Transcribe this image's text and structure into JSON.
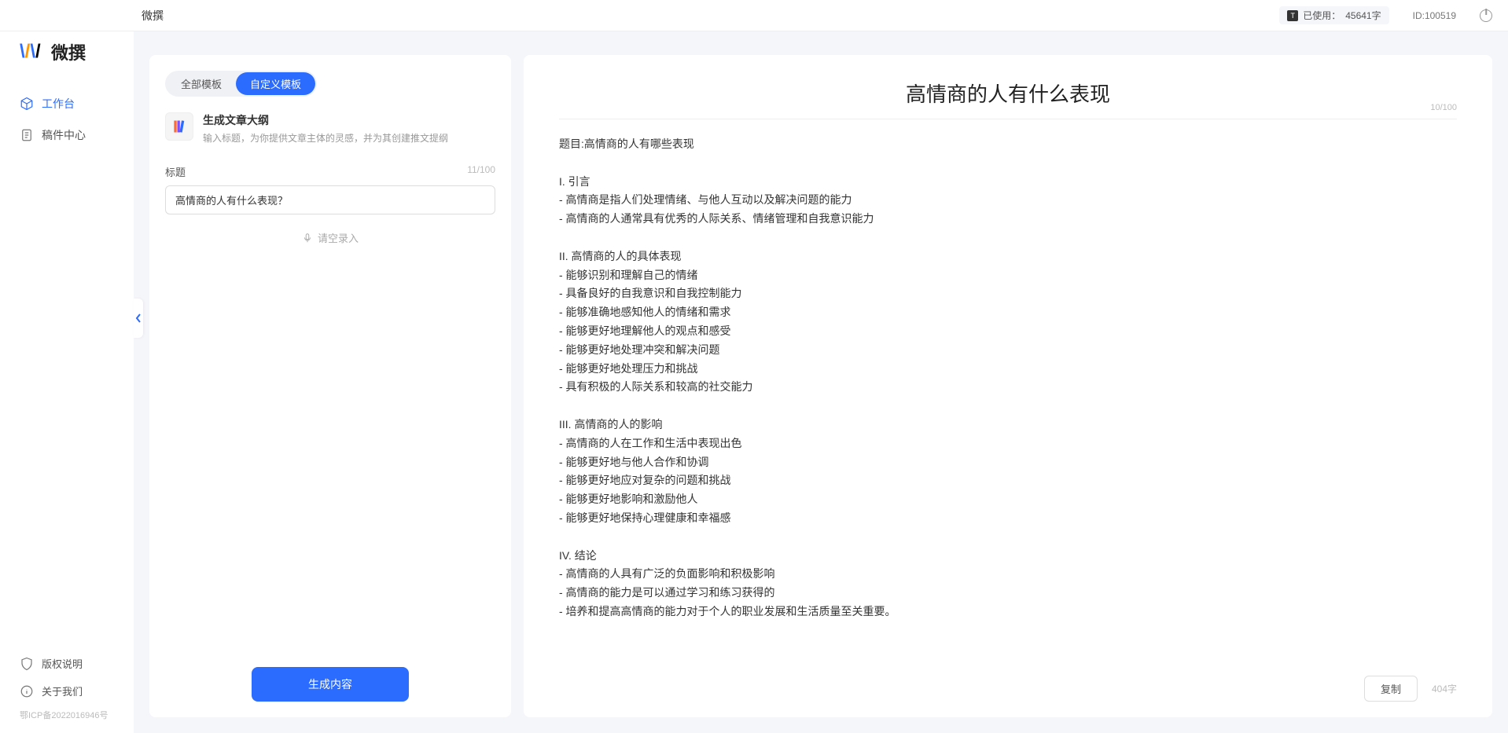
{
  "header": {
    "title": "微撰",
    "usage_label": "已使用：",
    "usage_value": "45641字",
    "user_id_label": "ID:",
    "user_id_value": "100519"
  },
  "logo": {
    "text": "微撰"
  },
  "sidebar": {
    "nav": [
      {
        "label": "工作台",
        "active": true
      },
      {
        "label": "稿件中心",
        "active": false
      }
    ],
    "footer": [
      {
        "label": "版权说明"
      },
      {
        "label": "关于我们"
      }
    ],
    "icp": "鄂ICP备2022016946号"
  },
  "leftPanel": {
    "tabs": [
      {
        "label": "全部模板",
        "active": false
      },
      {
        "label": "自定义模板",
        "active": true
      }
    ],
    "template": {
      "title": "生成文章大纲",
      "desc": "输入标题，为你提供文章主体的灵感，并为其创建推文提纲"
    },
    "titleField": {
      "label": "标题",
      "counter": "11/100",
      "value": "高情商的人有什么表现？"
    },
    "voice": "请空录入",
    "generate": "生成内容"
  },
  "rightPanel": {
    "title": "高情商的人有什么表现",
    "titleCounter": "10/100",
    "body": "题目:高情商的人有哪些表现\n\nI. 引言\n- 高情商是指人们处理情绪、与他人互动以及解决问题的能力\n- 高情商的人通常具有优秀的人际关系、情绪管理和自我意识能力\n\nII. 高情商的人的具体表现\n- 能够识别和理解自己的情绪\n- 具备良好的自我意识和自我控制能力\n- 能够准确地感知他人的情绪和需求\n- 能够更好地理解他人的观点和感受\n- 能够更好地处理冲突和解决问题\n- 能够更好地处理压力和挑战\n- 具有积极的人际关系和较高的社交能力\n\nIII. 高情商的人的影响\n- 高情商的人在工作和生活中表现出色\n- 能够更好地与他人合作和协调\n- 能够更好地应对复杂的问题和挑战\n- 能够更好地影响和激励他人\n- 能够更好地保持心理健康和幸福感\n\nIV. 结论\n- 高情商的人具有广泛的负面影响和积极影响\n- 高情商的能力是可以通过学习和练习获得的\n- 培养和提高高情商的能力对于个人的职业发展和生活质量至关重要。",
    "copy": "复制",
    "wordCount": "404字"
  }
}
